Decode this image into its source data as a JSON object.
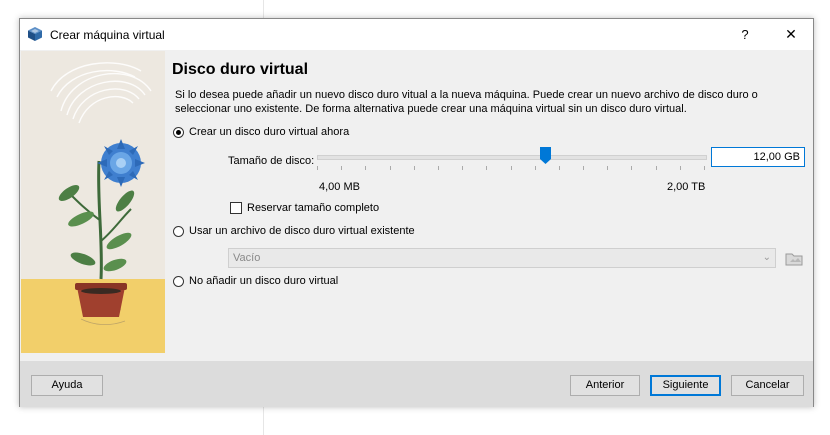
{
  "window": {
    "title": "Crear máquina virtual",
    "help_glyph": "?",
    "close_glyph": "✕"
  },
  "page": {
    "heading": "Disco duro virtual",
    "description": "Si lo desea puede añadir un nuevo disco duro vitual a la nueva máquina. Puede crear un nuevo archivo de disco duro o seleccionar uno existente. De forma alternativa puede crear una máquina virtual sin un disco duro virtual."
  },
  "options": {
    "create_new": {
      "label": "Crear un disco duro virtual ahora",
      "selected": true
    },
    "use_existing": {
      "label": "Usar un archivo de disco duro virtual existente",
      "selected": false
    },
    "no_disk": {
      "label": "No añadir un disco duro virtual",
      "selected": false
    }
  },
  "disk_size": {
    "label": "Tamaño de disco:",
    "value": "12,00 GB",
    "min_label": "4,00 MB",
    "max_label": "2,00 TB",
    "slider_fraction": 0.59
  },
  "preallocate": {
    "label": "Reservar tamaño completo",
    "checked": false
  },
  "existing_file": {
    "value": "Vacío"
  },
  "buttons": {
    "help": "Ayuda",
    "back": "Anterior",
    "next": "Siguiente",
    "cancel": "Cancelar"
  },
  "colors": {
    "accent": "#0078d7",
    "footer": "#dcdcdc",
    "dialog_bg": "#f0f0f0"
  },
  "icons": {
    "app": "virtualbox-cube-icon",
    "folder": "folder-browse-icon",
    "combo": "chevron-down-icon"
  }
}
